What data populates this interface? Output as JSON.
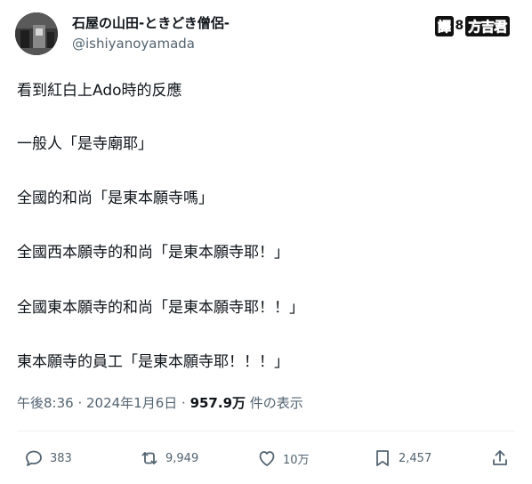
{
  "author": {
    "display_name": "石屋の山田-ときどき僧侶-",
    "handle": "@ishiyanoyamada"
  },
  "translator_badge": {
    "part1": "譯",
    "part2": "8",
    "part3": "方吉君"
  },
  "tweet_lines": [
    "看到紅白上Ado時的反應",
    "一般人「是寺廟耶」",
    "全國的和尚「是東本願寺嗎」",
    "全國西本願寺的和尚「是東本願寺耶！」",
    "全國東本願寺的和尚「是東本願寺耶！！」",
    "東本願寺的員工「是東本願寺耶！！！」"
  ],
  "meta": {
    "timestamp": "午後8:36 · 2024年1月6日 · ",
    "views": "957.9万",
    "views_suffix": " 件の表示"
  },
  "actions": {
    "replies": "383",
    "reposts": "9,949",
    "likes": "10万",
    "bookmarks": "2,457"
  },
  "colors": {
    "text": "#0f1419",
    "secondary": "#536471",
    "divider": "#eff3f4"
  },
  "icons": [
    "reply-icon",
    "repost-icon",
    "like-icon",
    "bookmark-icon",
    "share-icon"
  ]
}
